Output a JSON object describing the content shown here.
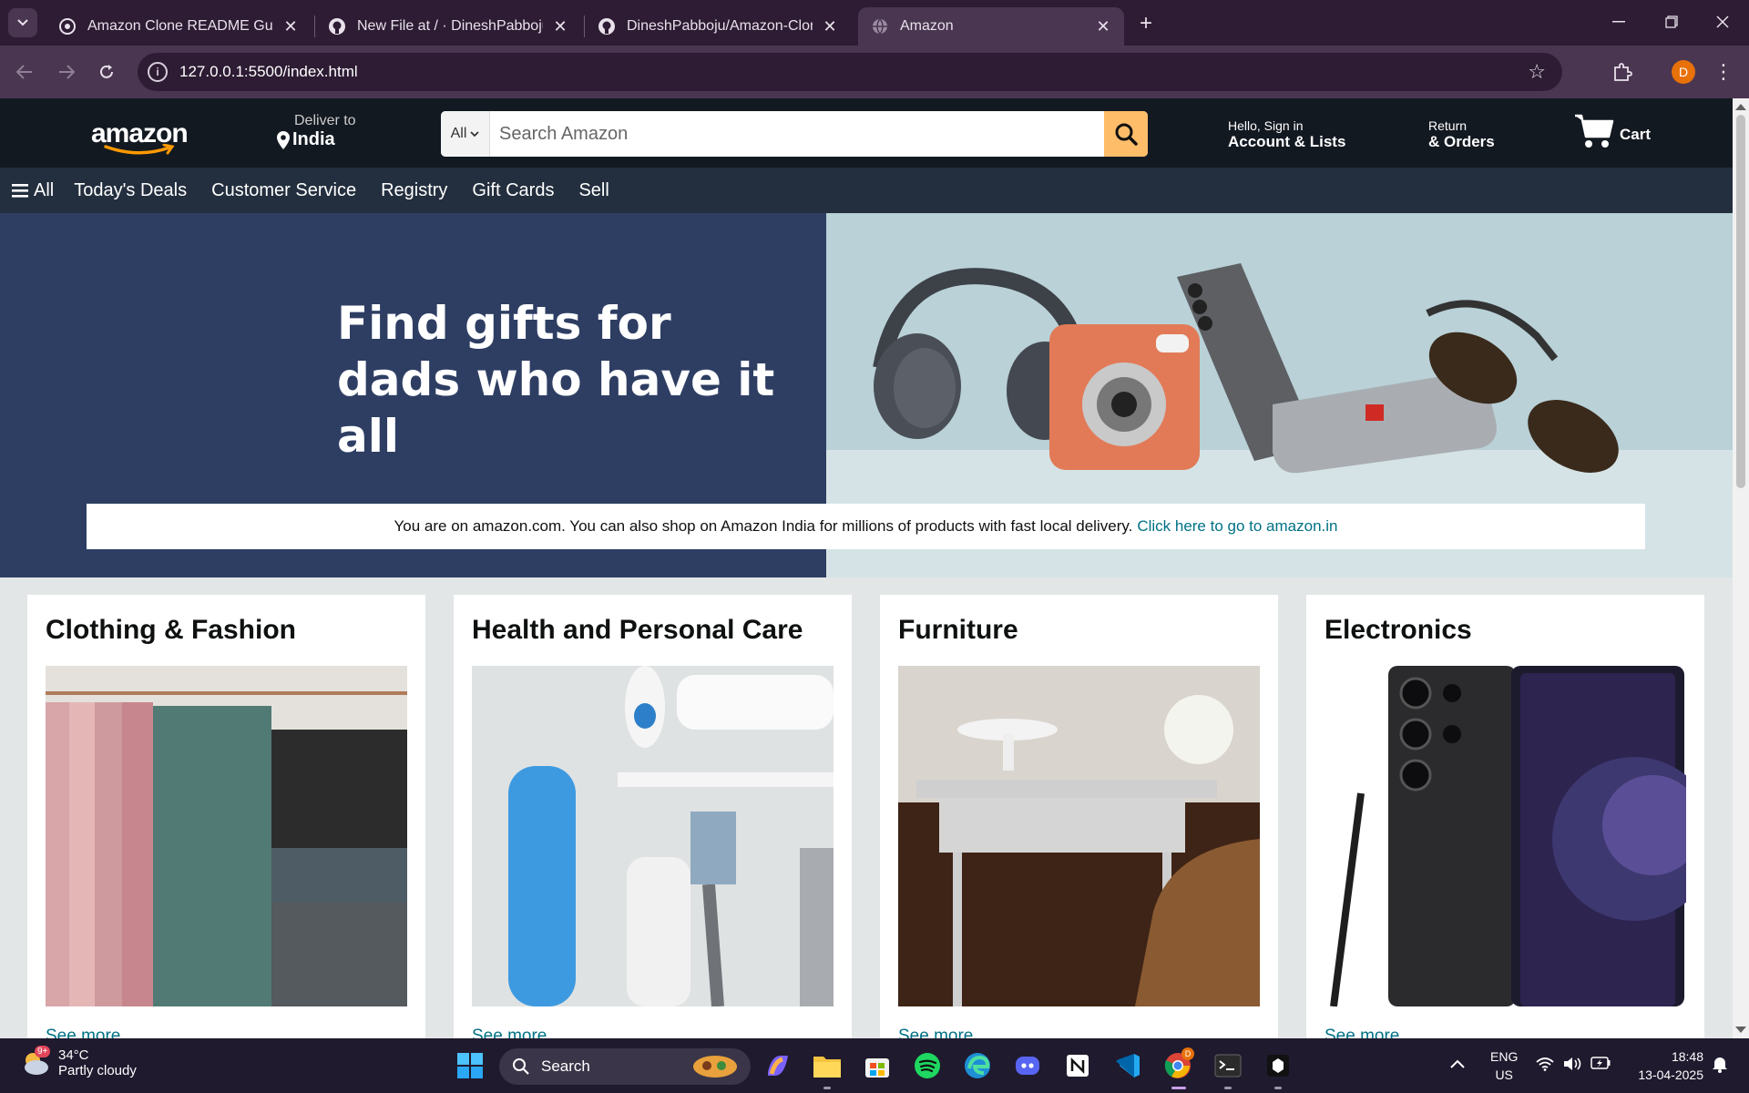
{
  "browser": {
    "tabs": [
      {
        "title": "Amazon Clone README Guide",
        "icon": "chatgpt-icon",
        "active": false
      },
      {
        "title": "New File at / · DineshPabboju/A",
        "icon": "github-icon",
        "active": false
      },
      {
        "title": "DineshPabboju/Amazon-Clone",
        "icon": "github-icon",
        "active": false
      },
      {
        "title": "Amazon",
        "icon": "globe-icon",
        "active": true
      }
    ],
    "url": "127.0.0.1:5500/index.html",
    "profile_initial": "D"
  },
  "header": {
    "logo_text": "amazon",
    "deliver_label": "Deliver to",
    "deliver_location": "India",
    "search_category": "All",
    "search_placeholder": "Search Amazon",
    "account_small": "Hello, Sign in",
    "account_big": "Account & Lists",
    "orders_small": "Return",
    "orders_big": "& Orders",
    "cart_label": "Cart"
  },
  "subnav": {
    "all_label": "All",
    "items": [
      "Today's Deals",
      "Customer Service",
      "Registry",
      "Gift Cards",
      "Sell"
    ]
  },
  "hero": {
    "headline_line1": "Find gifts for",
    "headline_line2": "dads who have it all",
    "notice_text": "You are on amazon.com. You can also shop on Amazon India for millions of products with fast local delivery.",
    "notice_link": "Click here to go to amazon.in"
  },
  "cards": [
    {
      "title": "Clothing & Fashion",
      "link": "See more"
    },
    {
      "title": "Health and Personal Care",
      "link": "See more"
    },
    {
      "title": "Furniture",
      "link": "See more"
    },
    {
      "title": "Electronics",
      "link": "See more"
    }
  ],
  "taskbar": {
    "weather_badge": "9+",
    "temperature": "34°C",
    "condition": "Partly cloudy",
    "search_label": "Search",
    "language_line1": "ENG",
    "language_line2": "US",
    "time": "18:48",
    "date": "13-04-2025"
  },
  "colors": {
    "amazon_header": "#131921",
    "amazon_subnav": "#232f3e",
    "search_button": "#febd69",
    "link": "#007185",
    "hero_left": "#2e3e63",
    "browser_frame": "#2d1c33"
  }
}
